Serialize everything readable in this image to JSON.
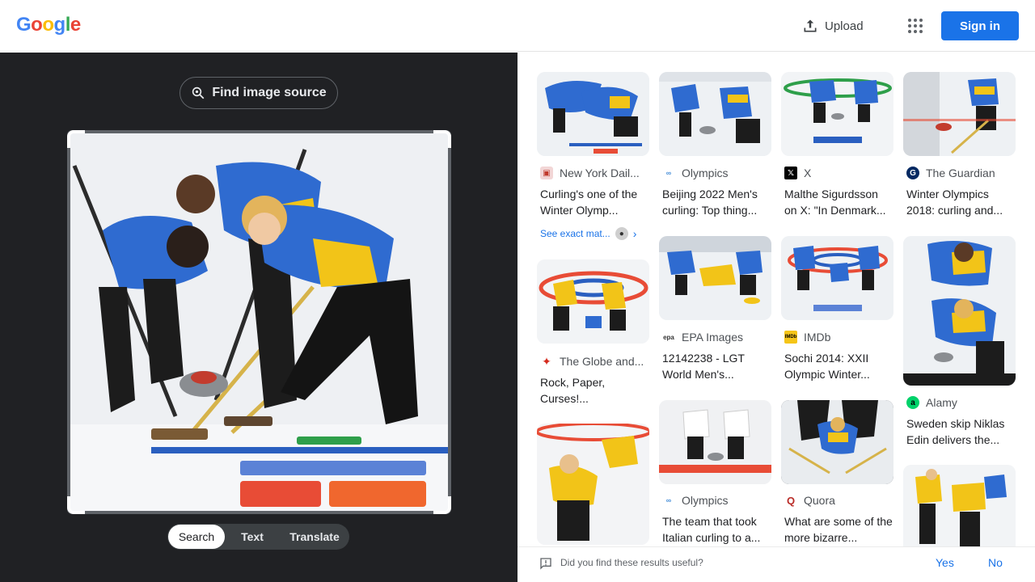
{
  "header": {
    "logo_letters": [
      {
        "ch": "G",
        "color": "#4285F4"
      },
      {
        "ch": "o",
        "color": "#EA4335"
      },
      {
        "ch": "o",
        "color": "#FBBC05"
      },
      {
        "ch": "g",
        "color": "#4285F4"
      },
      {
        "ch": "l",
        "color": "#34A853"
      },
      {
        "ch": "e",
        "color": "#EA4335"
      }
    ],
    "upload_label": "Upload",
    "upload_icon": "upload-icon",
    "apps_icon": "apps-grid-icon",
    "signin_label": "Sign in"
  },
  "left": {
    "find_source_label": "Find image source",
    "find_source_icon": "lens-search-icon",
    "tabs": [
      "Search",
      "Text",
      "Translate"
    ],
    "active_tab": "Search"
  },
  "results": [
    {
      "source": "New York Dail...",
      "title": "Curling's one of the Winter Olymp...",
      "icon_color": "#e8eaed",
      "icon_text": "N",
      "see_exact": "See exact mat..."
    },
    {
      "source": "Olympics",
      "title": "Beijing 2022 Men's curling: Top thing...",
      "icon_color": "#ffffff",
      "icon_text": "○"
    },
    {
      "source": "X",
      "title": "Malthe Sigurdsson on X: \"In Denmark...",
      "icon_color": "#000000",
      "icon_text": "X"
    },
    {
      "source": "The Guardian",
      "title": "Winter Olympics 2018: curling and...",
      "icon_color": "#052962",
      "icon_text": "G"
    },
    {
      "source": "The Globe and...",
      "title": "Rock, Paper, Curses!...",
      "icon_color": "#ffffff",
      "icon_text": "♠"
    },
    {
      "source": "EPA Images",
      "title": "12142238 - LGT World Men's...",
      "icon_color": "#ffffff",
      "icon_text": "epa"
    },
    {
      "source": "IMDb",
      "title": "Sochi 2014: XXII Olympic Winter...",
      "icon_color": "#f5c518",
      "icon_text": "IMDb"
    },
    {
      "source": "Alamy",
      "title": "Sweden skip Niklas Edin delivers the...",
      "icon_color": "#00d26a",
      "icon_text": "a"
    },
    {
      "source": "Olympics",
      "title": "The team that took Italian curling to a...",
      "icon_color": "#ffffff",
      "icon_text": "○"
    },
    {
      "source": "Quora",
      "title": "What are some of the more bizarre...",
      "icon_color": "#ffffff",
      "icon_text": "Q"
    }
  ],
  "feedback": {
    "question": "Did you find these results useful?",
    "yes": "Yes",
    "no": "No",
    "icon": "feedback-icon"
  },
  "colors": {
    "accent": "#1a73e8",
    "dark_pane": "#202124",
    "team_blue": "#2f6bd0",
    "team_yellow": "#f2c418"
  }
}
